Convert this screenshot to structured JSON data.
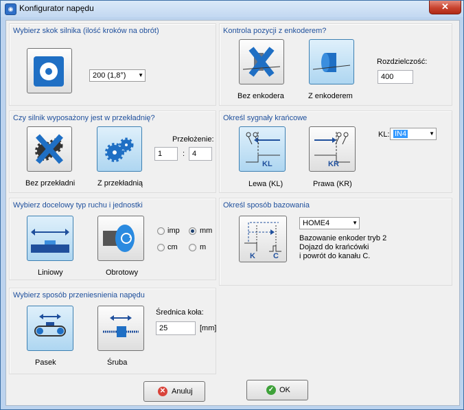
{
  "window": {
    "title": "Konfigurator napędu",
    "close_label": "✕"
  },
  "step": {
    "title": "Wybierz skok silnika (ilość kroków na obrót)",
    "value": "200   (1,8°)"
  },
  "encoder": {
    "title": "Kontrola pozycji z enkoderem?",
    "without_label": "Bez enkodera",
    "with_label": "Z enkoderem",
    "resolution_label": "Rozdzielczość:",
    "resolution_value": "400"
  },
  "gear": {
    "title": "Czy silnik wyposażony jest w przekładnię?",
    "without_label": "Bez przekładni",
    "with_label": "Z przekładnią",
    "ratio_label": "Przełożenie:",
    "ratio_a": "1",
    "ratio_sep": ":",
    "ratio_b": "4"
  },
  "limits": {
    "title": "Określ sygnały krańcowe",
    "left_label": "Lewa (KL)",
    "right_label": "Prawa (KR)",
    "kl_label": "KL:",
    "kl_value": "IN4",
    "kl_icon_text": "KL",
    "kr_icon_text": "KR"
  },
  "motion": {
    "title": "Wybierz docelowy typ ruchu i jednostki",
    "linear_label": "Liniowy",
    "rotary_label": "Obrotowy",
    "units": [
      {
        "label": "imp",
        "selected": false
      },
      {
        "label": "mm",
        "selected": true
      },
      {
        "label": "cm",
        "selected": false
      },
      {
        "label": "m",
        "selected": false
      }
    ]
  },
  "homing": {
    "title": "Określ sposób bazowania",
    "mode": "HOME4",
    "desc1": "Bazowanie enkoder tryb 2",
    "desc2": "Dojazd do krańcówki",
    "desc3": "i powrót do kanału C.",
    "icon_k": "K",
    "icon_c": "C"
  },
  "transmission": {
    "title": "Wybierz sposób przeniesnienia napędu",
    "belt_label": "Pasek",
    "screw_label": "Śruba",
    "diameter_label": "Średnica koła:",
    "diameter_value": "25",
    "unit": "[mm]"
  },
  "buttons": {
    "cancel": "Anuluj",
    "ok": "OK"
  },
  "colors": {
    "group_title": "#1e4f9c",
    "icon_blue": "#1f6fc4",
    "selected_bg": "#aed6f1"
  }
}
